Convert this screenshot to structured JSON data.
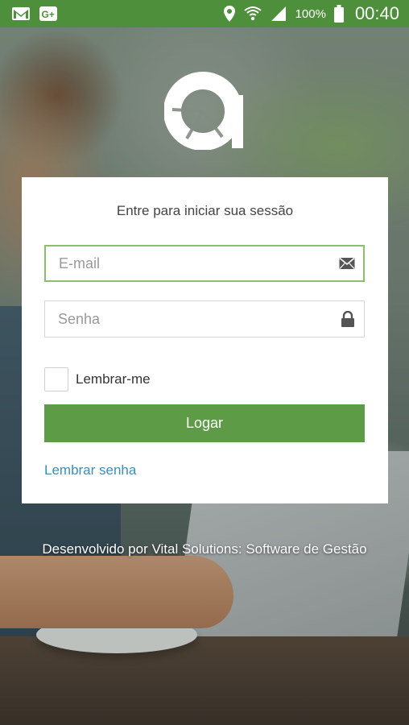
{
  "status_bar": {
    "battery_percent": "100%",
    "clock": "00:40",
    "background_color": "#4d8f3b",
    "icons": [
      "gmail-icon",
      "google-plus-icon",
      "location-icon",
      "wifi-icon",
      "signal-icon",
      "battery-icon"
    ]
  },
  "login": {
    "title": "Entre para iniciar sua sessão",
    "email_placeholder": "E-mail",
    "email_value": "",
    "password_placeholder": "Senha",
    "password_value": "",
    "remember_label": "Lembrar-me",
    "remember_checked": false,
    "submit_label": "Logar",
    "forgot_link": "Lembrar senha",
    "accent_color": "#5e9b46",
    "link_color": "#3c8dbc"
  },
  "footer": {
    "text": "Desenvolvido por Vital Solutions: Software de Gestão"
  }
}
